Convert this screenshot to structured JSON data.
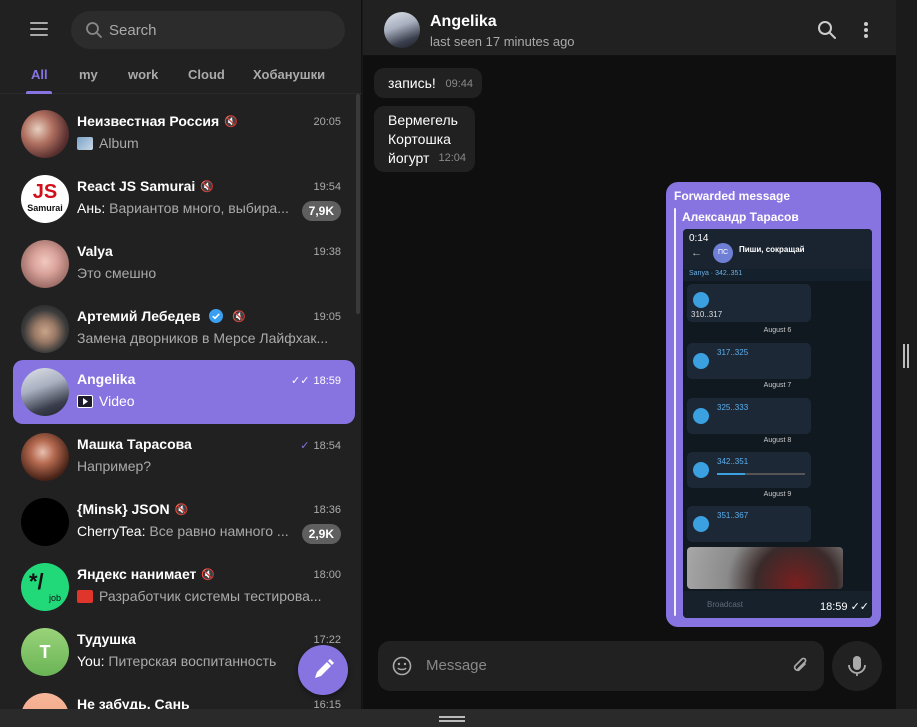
{
  "search": {
    "placeholder": "Search"
  },
  "tabs": [
    {
      "label": "All"
    },
    {
      "label": "my"
    },
    {
      "label": "work"
    },
    {
      "label": "Cloud"
    },
    {
      "label": "Хобанушки"
    }
  ],
  "chats": [
    {
      "name": "Неизвестная Россия",
      "time": "20:05",
      "preview": "Album",
      "sender": "",
      "badge": "",
      "muted": true
    },
    {
      "name": "React JS Samurai",
      "time": "19:54",
      "preview": "Вариантов много, выбира...",
      "sender": "Ань: ",
      "badge": "7,9K",
      "muted": true,
      "avatar_text": "JS",
      "avatar_sub": "Samurai"
    },
    {
      "name": "Valya",
      "time": "19:38",
      "preview": "Это смешно",
      "sender": "",
      "badge": ""
    },
    {
      "name": "Артемий Лебедев",
      "time": "19:05",
      "preview": "Замена дворников в Мерсе Лайфхак...",
      "sender": "",
      "badge": "",
      "muted": true,
      "verified": true
    },
    {
      "name": "Angelika",
      "time": "18:59",
      "preview": "Video",
      "sender": "",
      "badge": "",
      "selected": true,
      "read": true
    },
    {
      "name": "Машка Тарасова",
      "time": "18:54",
      "preview": "Например?",
      "sender": "",
      "badge": "",
      "read": true
    },
    {
      "name": "{Minsk} JSON",
      "time": "18:36",
      "preview": "Все равно намного ...",
      "sender": "CherryTea: ",
      "badge": "2,9K",
      "muted": true
    },
    {
      "name": "Яндекс нанимает",
      "time": "18:00",
      "preview": "Разработчик системы тестирова...",
      "sender": "",
      "badge": "",
      "muted": true,
      "avatar_text": "*/",
      "avatar_sub": "job"
    },
    {
      "name": "Тудушка",
      "time": "17:22",
      "preview": "Питерская воспитанность",
      "sender": "You: ",
      "badge": "",
      "avatar_text": "T"
    },
    {
      "name": "Не забудь, Сань",
      "time": "16:15",
      "preview": "",
      "sender": "",
      "badge": ""
    }
  ],
  "header": {
    "name": "Angelika",
    "status": "last seen 17 minutes ago"
  },
  "messages": [
    {
      "text": "запись!",
      "time": "09:44"
    },
    {
      "lines": [
        "Вермегель",
        "Кортошка",
        "йогурт"
      ],
      "time": "12:04"
    }
  ],
  "forward": {
    "label": "Forwarded message",
    "from": "Александр Тарасов",
    "time": "18:59",
    "video": {
      "duration": "0:14",
      "title": "Пиши, сокращай",
      "avatar": "ПС",
      "pinned": "Sanya · 342..351",
      "dates": [
        "August 6",
        "August 7",
        "August 8",
        "August 9"
      ],
      "tracks": [
        "310..317",
        "317..325",
        "325..333",
        "342..351",
        "351..367"
      ],
      "bottom_label": "Broadcast"
    }
  },
  "composer": {
    "placeholder": "Message"
  },
  "colors": {
    "accent": "#8774e1",
    "bg": "#0f0f0f",
    "panel": "#212121"
  }
}
